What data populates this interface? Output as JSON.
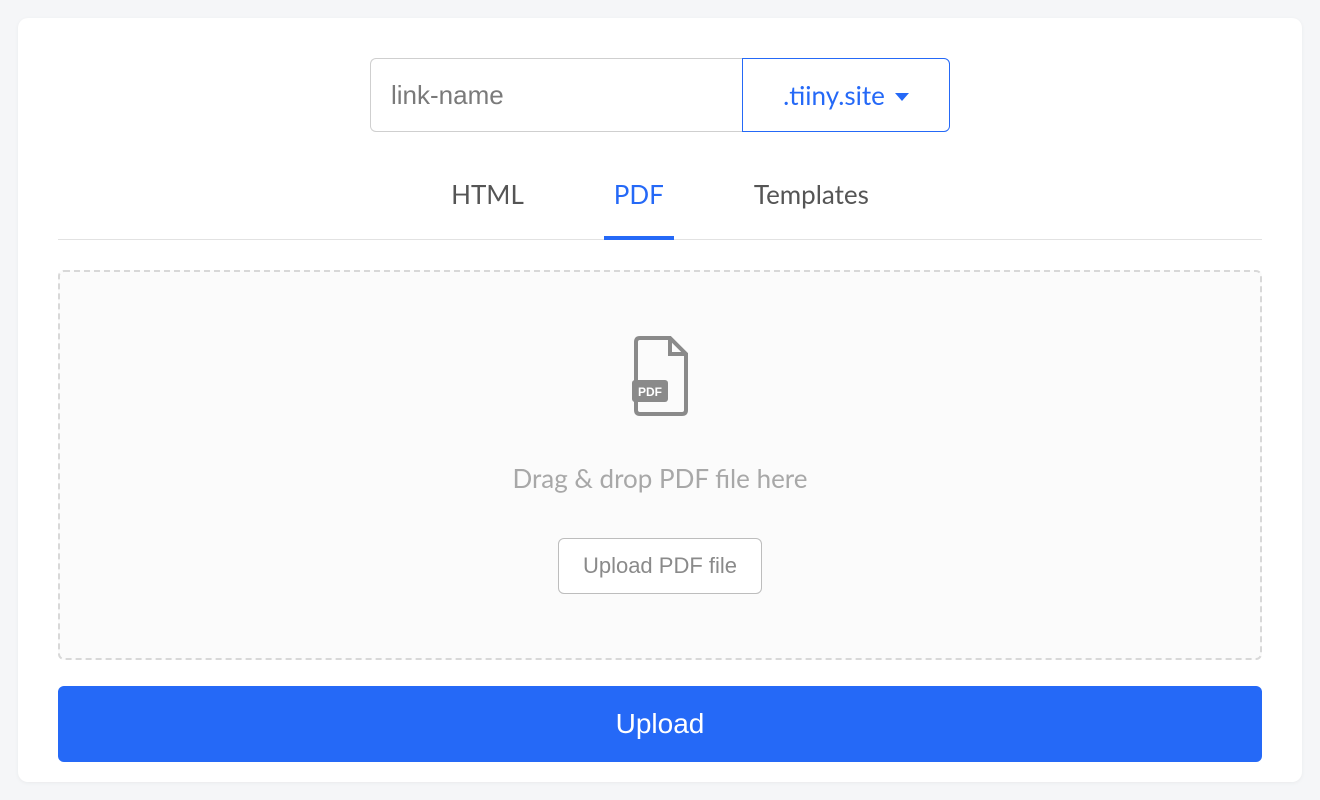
{
  "url_input": {
    "placeholder": "link-name",
    "domain": ".tiiny.site"
  },
  "tabs": {
    "html": "HTML",
    "pdf": "PDF",
    "templates": "Templates"
  },
  "dropzone": {
    "text": "Drag & drop PDF file here",
    "upload_file_button": "Upload PDF file",
    "pdf_badge": "PDF"
  },
  "upload_button": "Upload"
}
